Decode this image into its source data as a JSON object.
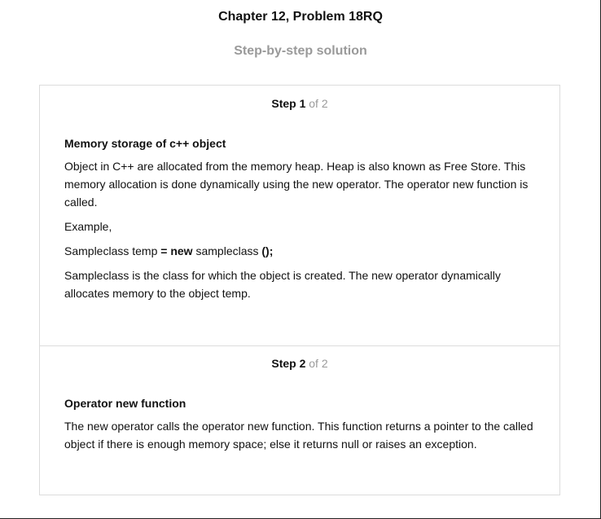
{
  "header": {
    "title": "Chapter 12, Problem 18RQ",
    "subtitle": "Step-by-step solution"
  },
  "steps": [
    {
      "label": "Step 1",
      "of": "of 2",
      "heading": "Memory storage of c++ object",
      "p1": "Object in C++ are allocated from the memory heap. Heap is also known as Free Store. This memory allocation is done dynamically using the new operator. The operator new function is called.",
      "p2": "Example,",
      "code": {
        "part1": "Sampleclass temp ",
        "part2": "= new",
        "part3": " sampleclass ",
        "part4": "();"
      },
      "p3": "Sampleclass is the class for which the object is created. The new operator dynamically allocates memory to the object temp."
    },
    {
      "label": "Step 2",
      "of": "of 2",
      "heading": "Operator new function",
      "p1": "The new operator calls the operator new function. This function returns a pointer to the called object if there is enough memory space; else it returns null or raises an exception."
    }
  ]
}
